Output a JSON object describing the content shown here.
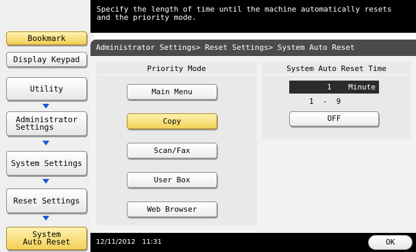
{
  "message": "Specify the length of time until the machine automatically resets\nand the priority mode.",
  "sidebar": {
    "bookmark": "Bookmark",
    "display_keypad": "Display Keypad",
    "nav": [
      {
        "label": "Utility"
      },
      {
        "label": "Administrator\nSettings"
      },
      {
        "label": "System Settings"
      },
      {
        "label": "Reset Settings"
      },
      {
        "label": "System\nAuto Reset"
      }
    ]
  },
  "breadcrumb": "Administrator Settings> Reset Settings> System Auto Reset",
  "priority_mode": {
    "title": "Priority Mode",
    "options": [
      "Main Menu",
      "Copy",
      "Scan/Fax",
      "User Box",
      "Web Browser"
    ],
    "selected": "Copy"
  },
  "auto_reset_time": {
    "title": "System Auto Reset Time",
    "value": "1",
    "unit": "Minute",
    "range": "1  -  9",
    "off_label": "OFF"
  },
  "footer": {
    "date": "12/11/2012",
    "time": "11:31",
    "ok_label": "OK"
  },
  "colors": {
    "accent_yellow": "#f2cf57",
    "arrow_blue": "#1f56d6",
    "header_dark": "#4b4b4b"
  }
}
